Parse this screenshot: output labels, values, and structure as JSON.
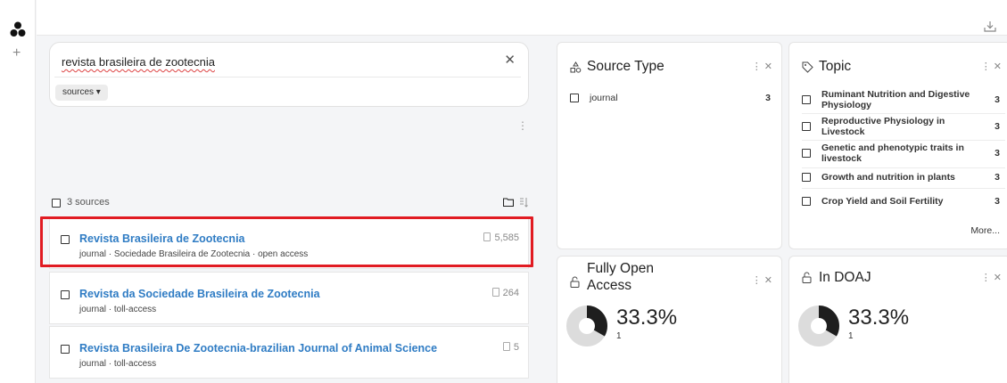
{
  "search": {
    "query": "revista brasileira de zootecnia",
    "clear_icon": "✕",
    "scope_chip": "sources ▾"
  },
  "list": {
    "count_label": "3 sources",
    "items": [
      {
        "title": "Revista Brasileira de Zootecnia",
        "meta": "journal · Sociedade Brasileira de Zootecnia · open access",
        "doc_count": "5,585",
        "highlighted": true
      },
      {
        "title": "Revista da Sociedade Brasileira de Zootecnia",
        "meta": "journal · toll-access",
        "doc_count": "264",
        "highlighted": false
      },
      {
        "title": "Revista Brasileira De Zootecnia-brazilian Journal of Animal Science",
        "meta": "journal · toll-access",
        "doc_count": "5",
        "highlighted": false
      }
    ]
  },
  "source_type_card": {
    "title": "Source Type",
    "icon": "shapes-icon",
    "actions": "⋮ ✕",
    "rows": [
      {
        "label": "journal",
        "count": "3"
      }
    ]
  },
  "topic_card": {
    "title": "Topic",
    "icon": "tag-icon",
    "actions": "⋮ ✕",
    "rows": [
      {
        "label": "Ruminant Nutrition and Digestive Physiology",
        "count": "3"
      },
      {
        "label": "Reproductive Physiology in Livestock",
        "count": "3"
      },
      {
        "label": "Genetic and phenotypic traits in livestock",
        "count": "3"
      },
      {
        "label": "Growth and nutrition in plants",
        "count": "3"
      },
      {
        "label": "Crop Yield and Soil Fertility",
        "count": "3"
      }
    ],
    "more_label": "More..."
  },
  "open_access_card": {
    "title": "Fully Open Access",
    "icon": "unlock-icon",
    "actions": "⋮ ✕",
    "percent": "33.3%",
    "count": "1",
    "fraction": 0.333
  },
  "doaj_card": {
    "title": "In DOAJ",
    "icon": "unlock-icon",
    "actions": "⋮ ✕",
    "percent": "33.3%",
    "count": "1",
    "fraction": 0.333
  },
  "colors": {
    "link": "#2f7cc4",
    "highlight": "#e11b22",
    "donut_dark": "#1e1e1e",
    "donut_light": "#dcdcdc"
  }
}
